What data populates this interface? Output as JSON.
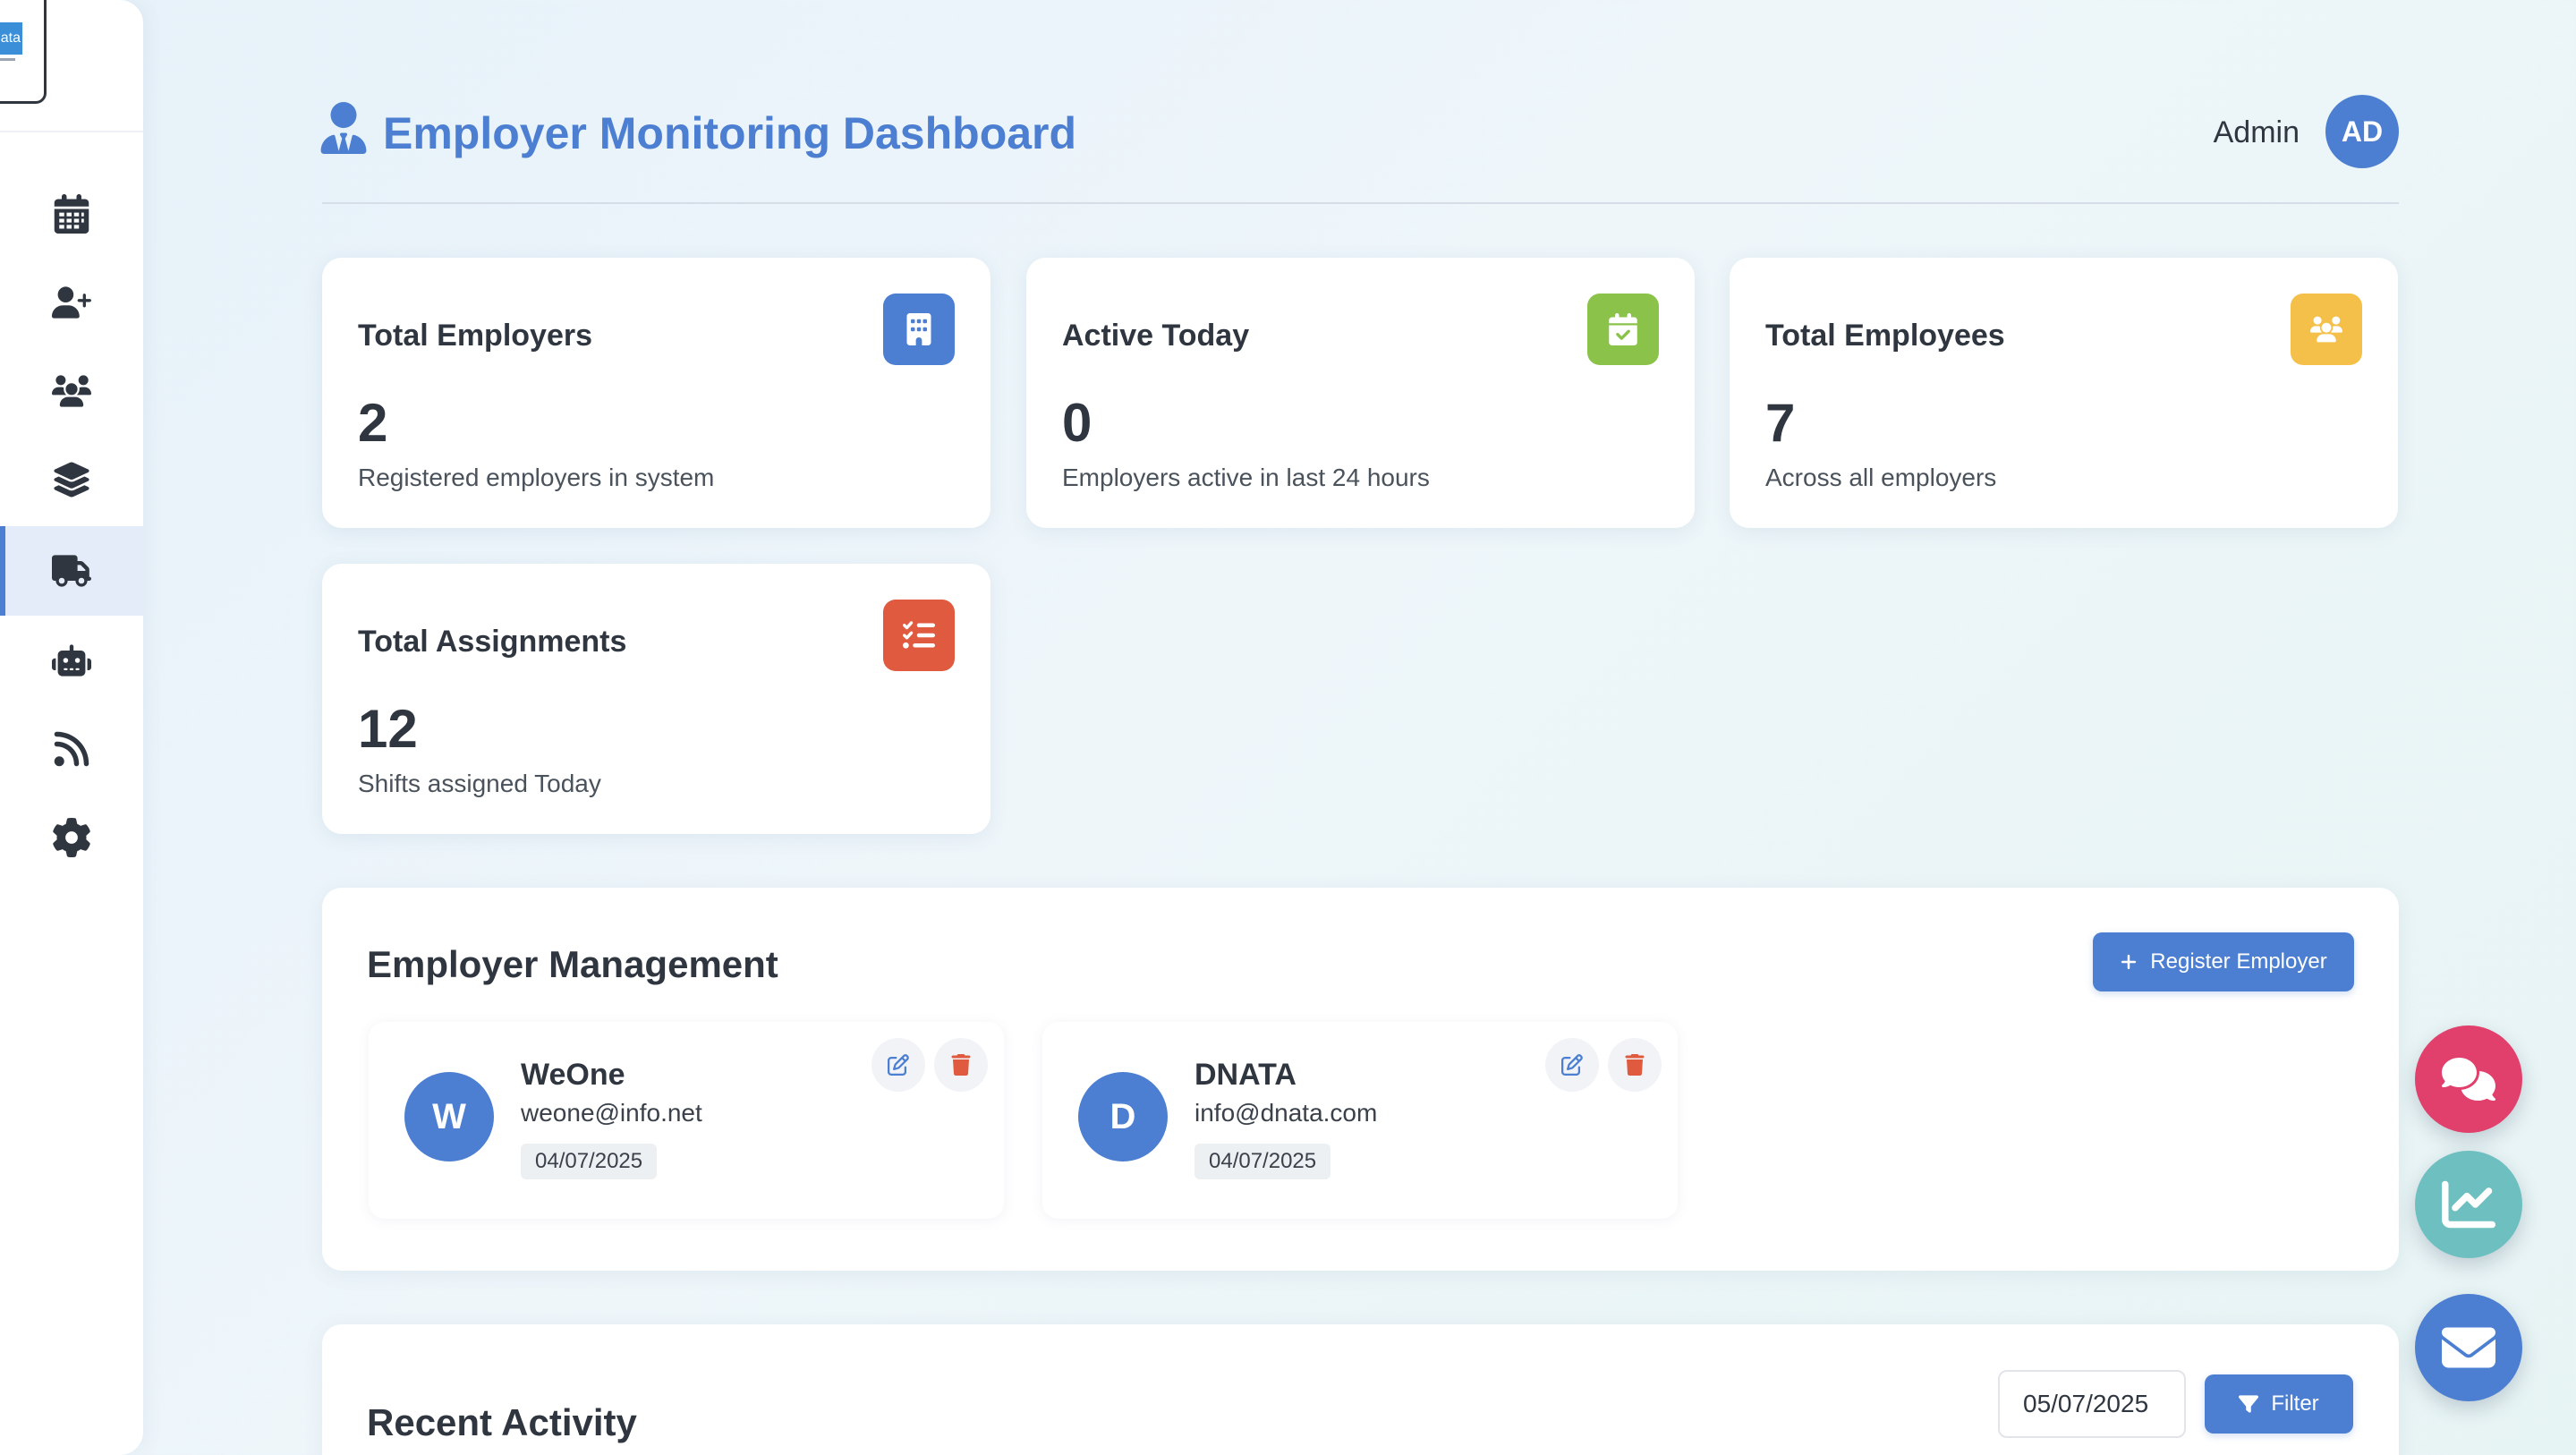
{
  "header": {
    "title": "Employer Monitoring Dashboard",
    "user_label": "Admin",
    "avatar_initials": "AD"
  },
  "sidebar": {
    "logo_text": "ata",
    "items": [
      {
        "icon": "calendar-icon",
        "active": false
      },
      {
        "icon": "user-plus-icon",
        "active": false
      },
      {
        "icon": "users-icon",
        "active": false
      },
      {
        "icon": "layers-icon",
        "active": false
      },
      {
        "icon": "truck-icon",
        "active": true
      },
      {
        "icon": "robot-icon",
        "active": false
      },
      {
        "icon": "rss-icon",
        "active": false
      },
      {
        "icon": "gear-icon",
        "active": false
      }
    ]
  },
  "stats": [
    {
      "title": "Total Employers",
      "value": "2",
      "desc": "Registered employers in system",
      "icon": "building-icon",
      "color": "#4c7fd1"
    },
    {
      "title": "Active Today",
      "value": "0",
      "desc": "Employers active in last 24 hours",
      "icon": "calendar-check-icon",
      "color": "#8bc34a"
    },
    {
      "title": "Total Employees",
      "value": "7",
      "desc": "Across all employers",
      "icon": "users-icon",
      "color": "#f5c04a"
    },
    {
      "title": "Total Assignments",
      "value": "12",
      "desc": "Shifts assigned Today",
      "icon": "tasks-icon",
      "color": "#e05a3f"
    }
  ],
  "employer_management": {
    "title": "Employer Management",
    "register_button": "Register Employer",
    "employers": [
      {
        "initial": "W",
        "name": "WeOne",
        "email": "weone@info.net",
        "date": "04/07/2025"
      },
      {
        "initial": "D",
        "name": "DNATA",
        "email": "info@dnata.com",
        "date": "04/07/2025"
      }
    ]
  },
  "recent_activity": {
    "title": "Recent Activity",
    "date_value": "05/07/2025",
    "filter_button": "Filter"
  },
  "fabs": [
    {
      "icon": "comments-icon",
      "color": "#e0406b"
    },
    {
      "icon": "chart-line-icon",
      "color": "#6ec0c0"
    },
    {
      "icon": "envelope-icon",
      "color": "#4c7fd1"
    }
  ],
  "colors": {
    "accent": "#4c7fd1",
    "text": "#2f3640",
    "active_nav_bg": "#e3ecf8",
    "edit": "#4c7fd1",
    "delete": "#e05a3f"
  }
}
